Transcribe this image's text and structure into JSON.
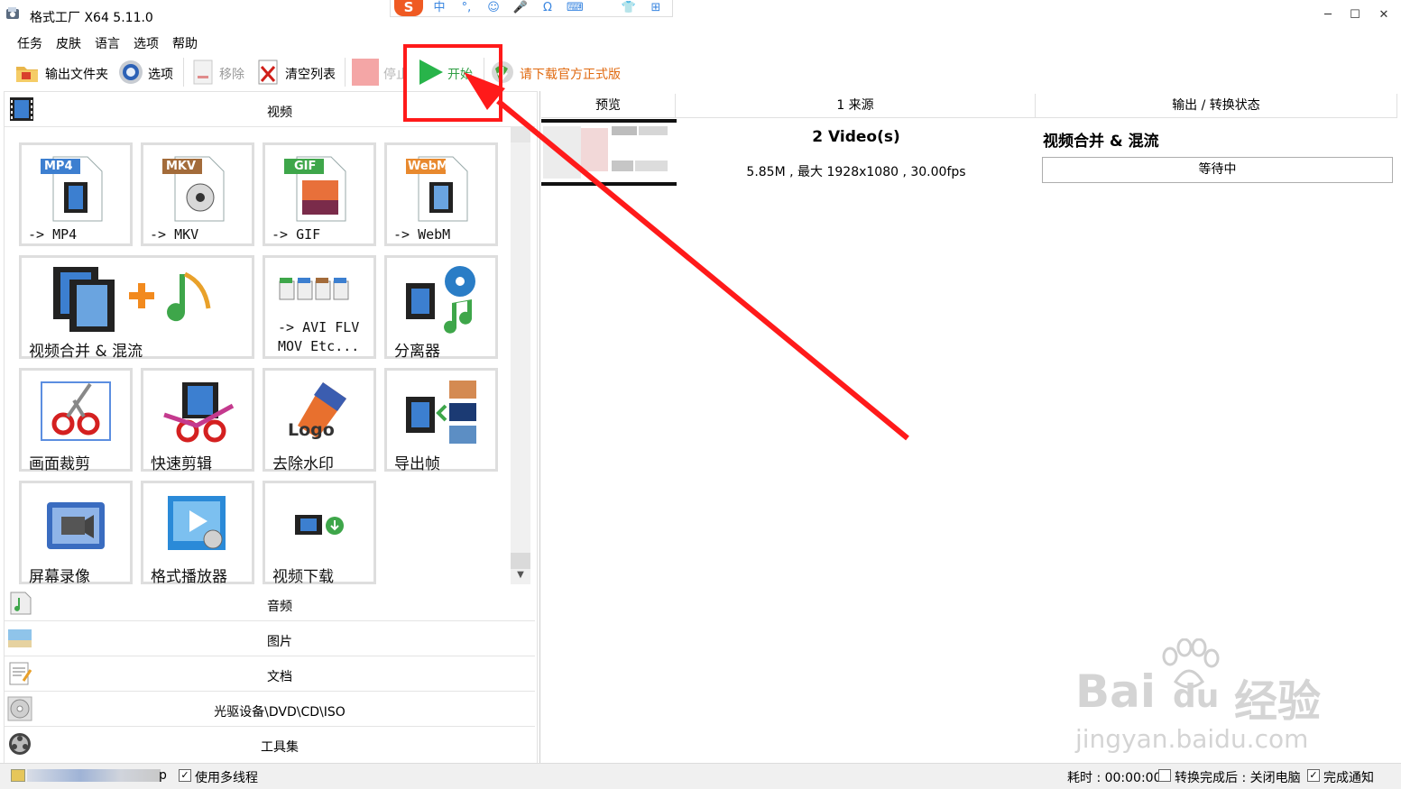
{
  "window": {
    "title": "格式工厂 X64 5.11.0",
    "minimize": "─",
    "maximize": "☐",
    "close": "✕"
  },
  "ime": {
    "logo": "S",
    "items": [
      "中",
      "°,",
      "☺",
      "🎤",
      "Ω",
      "⌨",
      "👕",
      "⊞"
    ]
  },
  "menu": [
    "任务",
    "皮肤",
    "语言",
    "选项",
    "帮助"
  ],
  "toolbar": {
    "output_folder": "输出文件夹",
    "options": "选项",
    "remove": "移除",
    "clear_list": "清空列表",
    "stop": "停止",
    "start": "开始",
    "download_official": "请下载官方正式版"
  },
  "categories": {
    "video": "视频",
    "audio": "音频",
    "image": "图片",
    "document": "文档",
    "optical": "光驱设备\\DVD\\CD\\ISO",
    "tools": "工具集"
  },
  "tiles": {
    "mp4": {
      "badge": "MP4",
      "label": "-> MP4"
    },
    "mkv": {
      "badge": "MKV",
      "label": "-> MKV"
    },
    "gif": {
      "badge": "GIF",
      "label": "-> GIF"
    },
    "webm": {
      "badge": "WebM",
      "label": "-> WebM"
    },
    "merge": {
      "label": "视频合并 & 混流"
    },
    "avi_line1": "-> AVI FLV",
    "avi_line2": "MOV Etc...",
    "splitter": "分离器",
    "crop": "画面裁剪",
    "quick_cut": "快速剪辑",
    "logo_text": "Logo",
    "remove_watermark": "去除水印",
    "export_frames": "导出帧",
    "screen_record": "屏幕录像",
    "player": "格式播放器",
    "video_download": "视频下载"
  },
  "task_table": {
    "columns": [
      "预览",
      "1 来源",
      "输出 / 转换状态"
    ],
    "rows": [
      {
        "source_title": "2 Video(s)",
        "source_info": "5.85M , 最大 1928x1080 , 30.00fps",
        "output_title": "视频合并 & 混流",
        "status": "等待中"
      }
    ]
  },
  "statusbar": {
    "multithread": "使用多线程",
    "elapsed": "耗时 : 00:00:00",
    "after_convert": "转换完成后 : 关闭电脑",
    "notify": "完成通知",
    "suffix": "p"
  },
  "watermark": {
    "line1": "Bai",
    "line1b": "du",
    "line1c": "经验",
    "line2": "jingyan.baidu.com"
  },
  "colors": {
    "accent_green": "#28b44a",
    "annotation_red": "#ff1a1a",
    "download_orange": "#e06a10"
  }
}
